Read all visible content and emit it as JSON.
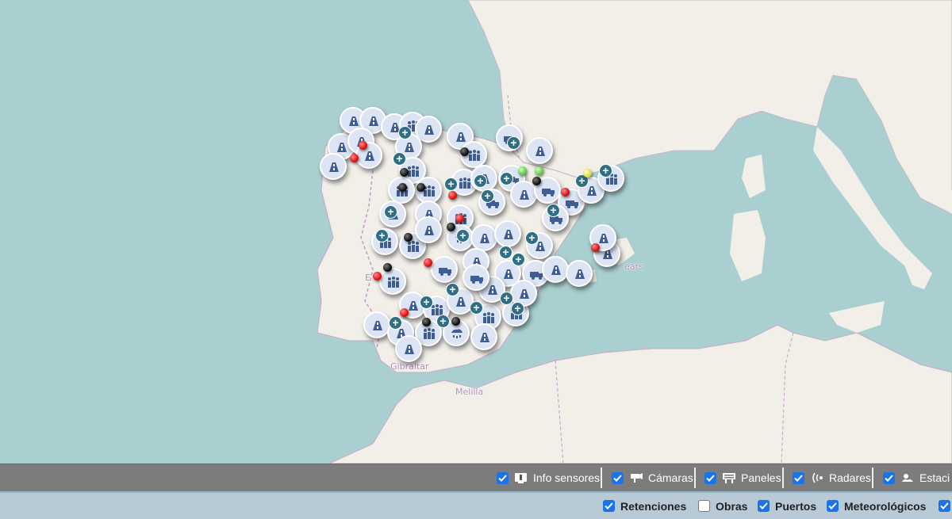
{
  "map": {
    "labels": {
      "gibraltar": "Gibraltar",
      "melilla": "Melilla",
      "balears": "ears",
      "extremadura_fragment": "E"
    },
    "colors": {
      "sea": "#aacfd0",
      "land": "#f2efe9",
      "marker": "#dde5f4",
      "icon": "#3d5d94"
    }
  },
  "layer_bar": {
    "items": [
      {
        "label": "Info sensores",
        "icon": "info-sensor-icon",
        "checked": true
      },
      {
        "label": "Cámaras",
        "icon": "camera-icon",
        "checked": true
      },
      {
        "label": "Paneles",
        "icon": "panel-icon",
        "checked": true
      },
      {
        "label": "Radares",
        "icon": "radar-icon",
        "checked": true
      },
      {
        "label": "Estaci",
        "icon": "weather-station-icon",
        "checked": true
      }
    ]
  },
  "filter_bar": {
    "items": [
      {
        "label": "Retenciones",
        "checked": true
      },
      {
        "label": "Obras",
        "checked": false
      },
      {
        "label": "Puertos",
        "checked": true
      },
      {
        "label": "Meteorológicos",
        "checked": true
      }
    ]
  }
}
